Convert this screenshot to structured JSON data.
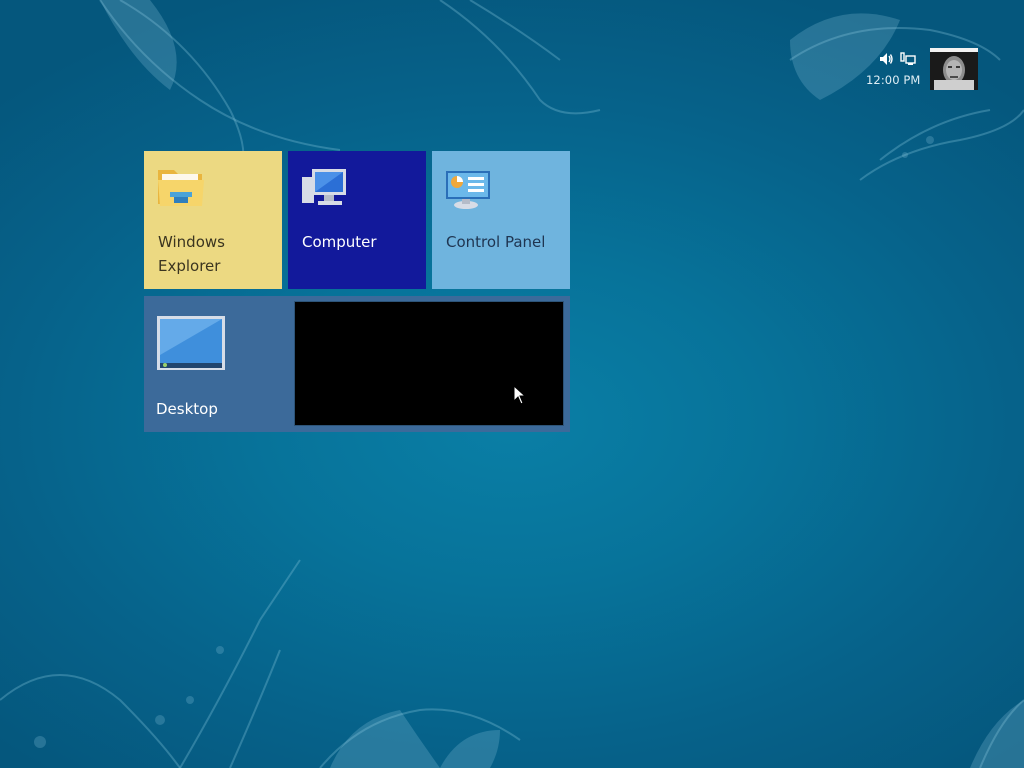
{
  "status_bar": {
    "time": "12:00 PM",
    "icons": [
      "speaker-icon",
      "network-icon"
    ]
  },
  "user": {
    "avatar": "user-avatar"
  },
  "tiles": [
    {
      "label": "Windows Explorer",
      "icon": "folder-icon",
      "color": "#ecd982"
    },
    {
      "label": "Computer",
      "icon": "computer-icon",
      "color": "#12199b"
    },
    {
      "label": "Control Panel",
      "icon": "control-panel-icon",
      "color": "#6fb4de"
    },
    {
      "label": "Desktop",
      "icon": "desktop-icon",
      "color": "#3c6a9a"
    }
  ],
  "colors": {
    "background": "#07739a",
    "preview": "#000000"
  }
}
